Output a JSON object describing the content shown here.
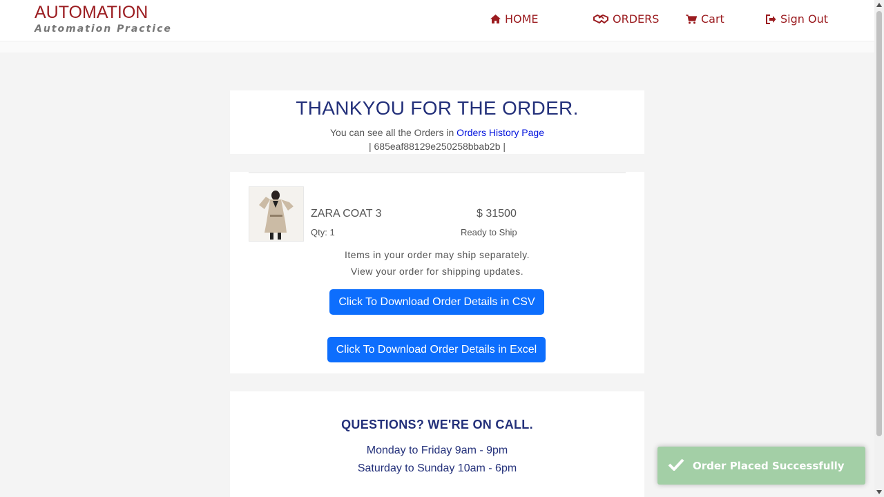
{
  "brand": {
    "title": "AUTOMATION",
    "subtitle": "Automation Practice"
  },
  "nav": {
    "home": "HOME",
    "orders": "ORDERS",
    "cart": "Cart",
    "signout": "Sign Out"
  },
  "confirmation": {
    "heading": "THANKYOU FOR THE ORDER.",
    "history_prefix": "You can see all the Orders in",
    "history_link": "Orders History Page",
    "order_id": "| 685eaf88129e250258bbab2b |"
  },
  "product": {
    "name": "ZARA COAT 3",
    "price": "$ 31500",
    "qty": "Qty: 1",
    "status": "Ready to Ship",
    "image_icon": "coat-product-image"
  },
  "shipping": {
    "line1": "Items in your order may ship separately.",
    "line2": "View your order for shipping updates."
  },
  "buttons": {
    "csv": "Click To Download Order Details in CSV",
    "excel": "Click To Download Order Details in Excel"
  },
  "support": {
    "title": "QUESTIONS? WE'RE ON CALL.",
    "weekday": "Monday to Friday 9am - 9pm",
    "weekend": "Saturday to Sunday 10am - 6pm"
  },
  "toast": {
    "message": "Order Placed Successfully"
  },
  "colors": {
    "brand": "#9b1c20",
    "heading": "#23307a",
    "button": "#0d6efd",
    "toast": "#a3cfa6",
    "link": "#0011dd"
  }
}
